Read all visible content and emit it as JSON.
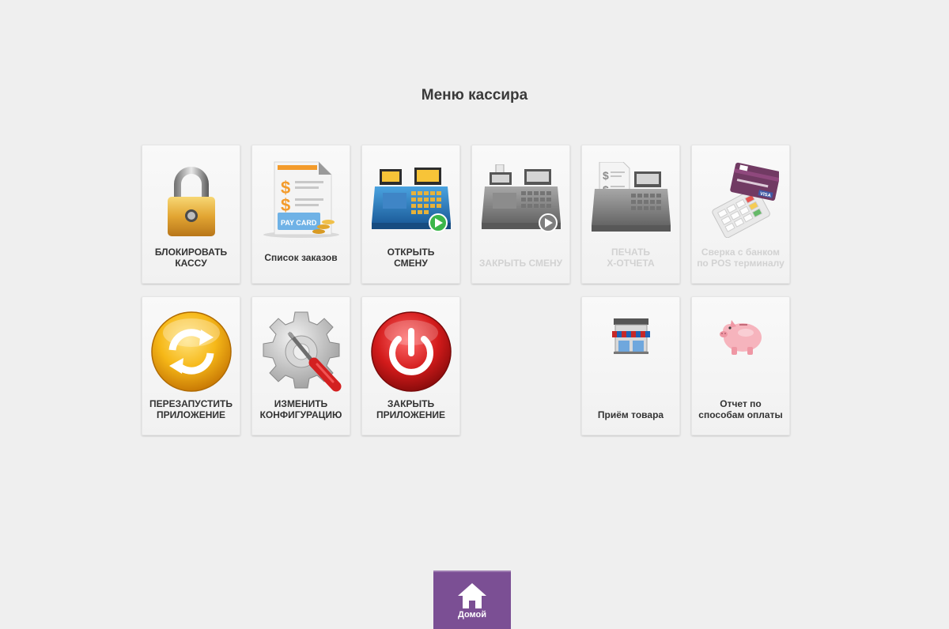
{
  "header": {
    "title": "Меню кассира"
  },
  "tiles": [
    {
      "label": "БЛОКИРОВАТЬ\nКАССУ",
      "icon": "padlock-icon",
      "enabled": true
    },
    {
      "label": "Список заказов",
      "icon": "pay-card-document-icon",
      "enabled": true,
      "icon_text": "PAY CARD"
    },
    {
      "label": "ОТКРЫТЬ\nСМЕНУ",
      "icon": "cash-register-play-icon",
      "enabled": true
    },
    {
      "label": "ЗАКРЫТЬ СМЕНУ",
      "icon": "cash-register-grey-icon",
      "enabled": false
    },
    {
      "label": "ПЕЧАТЬ\nX-ОТЧЕТА",
      "icon": "cash-register-receipt-icon",
      "enabled": false
    },
    {
      "label": "Сверка с банком\nпо POS терминалу",
      "icon": "pos-terminal-card-icon",
      "enabled": false,
      "icon_text": "VISA"
    },
    {
      "label": "ПЕРЕЗАПУСТИТЬ\nПРИЛОЖЕНИЕ",
      "icon": "refresh-icon",
      "enabled": true
    },
    {
      "label": "ИЗМЕНИТЬ\nКОНФИГУРАЦИЮ",
      "icon": "gear-screwdriver-icon",
      "enabled": true
    },
    {
      "label": "ЗАКРЫТЬ\nПРИЛОЖЕНИЕ",
      "icon": "power-icon",
      "enabled": true
    },
    {
      "label": "Приём товара",
      "icon": "store-icon",
      "enabled": true
    },
    {
      "label": "Отчет по\nспособам оплаты",
      "icon": "piggy-bank-icon",
      "enabled": true
    }
  ],
  "footer": {
    "home_label": "Домой",
    "home_icon": "home-icon"
  },
  "colors": {
    "background": "#efefef",
    "home_button": "#7b4f94",
    "disabled_text": "#d2d2d2"
  }
}
